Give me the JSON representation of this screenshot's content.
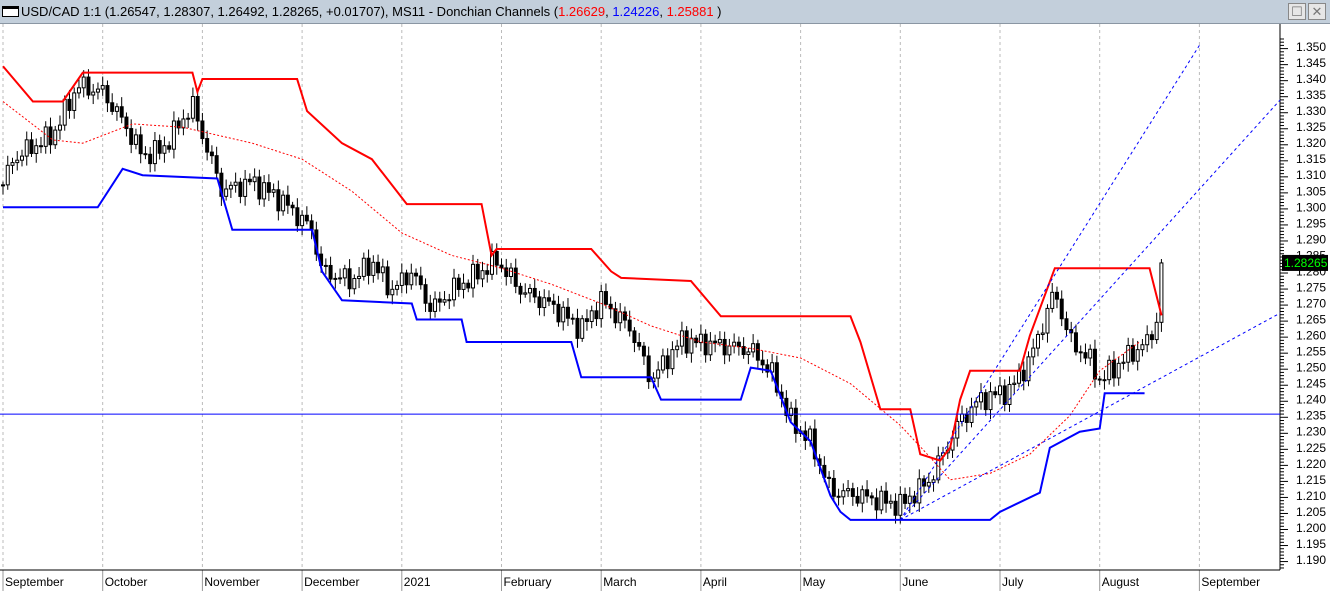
{
  "window": {
    "symbol_info": "USD/CAD 1:1 (1.26547, 1.28307, 1.26492, 1.28265, +0.01707), MS11 - Donchian Channels (",
    "upper": "1.26629",
    "sep1": ", ",
    "lower": "1.24226",
    "sep2": ", ",
    "middle": "1.25881",
    "close_paren": " )",
    "maximize": "☐",
    "close": "✕"
  },
  "colors": {
    "upper": "#ff0000",
    "lower": "#0000ff",
    "middle": "#ff0000",
    "current_price_bg": "#000000",
    "current_price_fg": "#00ff00"
  },
  "chart_data": {
    "type": "candlestick",
    "title": "USD/CAD 1:1",
    "ylim": [
      1.1875,
      1.3525
    ],
    "y_ticks": [
      "1.350",
      "1.345",
      "1.340",
      "1.335",
      "1.330",
      "1.325",
      "1.320",
      "1.315",
      "1.310",
      "1.305",
      "1.300",
      "1.295",
      "1.290",
      "1.285",
      "1.280",
      "1.275",
      "1.270",
      "1.265",
      "1.260",
      "1.255",
      "1.250",
      "1.245",
      "1.240",
      "1.235",
      "1.230",
      "1.225",
      "1.220",
      "1.215",
      "1.210",
      "1.205",
      "1.200",
      "1.195",
      "1.190"
    ],
    "x_labels": [
      "September",
      "October",
      "November",
      "December",
      "2021",
      "February",
      "March",
      "April",
      "May",
      "June",
      "July",
      "August",
      "September"
    ],
    "current_price": "1.28265",
    "close_path": [
      [
        0,
        1.307
      ],
      [
        0.1,
        1.315
      ],
      [
        0.25,
        1.318
      ],
      [
        0.5,
        1.3225
      ],
      [
        0.75,
        1.338
      ],
      [
        1.0,
        1.336
      ],
      [
        1.2,
        1.327
      ],
      [
        1.4,
        1.316
      ],
      [
        1.6,
        1.318
      ],
      [
        1.9,
        1.332
      ],
      [
        2.05,
        1.318
      ],
      [
        2.2,
        1.305
      ],
      [
        2.5,
        1.308
      ],
      [
        2.8,
        1.302
      ],
      [
        3.1,
        1.293
      ],
      [
        3.2,
        1.28
      ],
      [
        3.5,
        1.277
      ],
      [
        3.7,
        1.283
      ],
      [
        3.9,
        1.274
      ],
      [
        4.1,
        1.28
      ],
      [
        4.3,
        1.268
      ],
      [
        4.5,
        1.274
      ],
      [
        4.8,
        1.28
      ],
      [
        4.95,
        1.2835
      ],
      [
        5.2,
        1.274
      ],
      [
        5.5,
        1.2695
      ],
      [
        5.8,
        1.262
      ],
      [
        6.0,
        1.271
      ],
      [
        6.3,
        1.262
      ],
      [
        6.5,
        1.246
      ],
      [
        6.8,
        1.2585
      ],
      [
        7.2,
        1.257
      ],
      [
        7.5,
        1.2555
      ],
      [
        7.7,
        1.249
      ],
      [
        7.9,
        1.2335
      ],
      [
        8.1,
        1.227
      ],
      [
        8.3,
        1.2115
      ],
      [
        8.6,
        1.21
      ],
      [
        9.0,
        1.207
      ],
      [
        9.3,
        1.215
      ],
      [
        9.6,
        1.2335
      ],
      [
        9.8,
        1.24
      ],
      [
        10.1,
        1.243
      ],
      [
        10.3,
        1.2525
      ],
      [
        10.55,
        1.274
      ],
      [
        10.7,
        1.2585
      ],
      [
        10.9,
        1.2525
      ],
      [
        11.0,
        1.246
      ],
      [
        11.3,
        1.254
      ],
      [
        11.5,
        1.2585
      ],
      [
        11.58,
        1.266
      ],
      [
        11.62,
        1.28265
      ]
    ],
    "donchian_upper": [
      [
        0,
        1.344
      ],
      [
        0.3,
        1.333
      ],
      [
        0.6,
        1.333
      ],
      [
        0.8,
        1.342
      ],
      [
        1.9,
        1.342
      ],
      [
        1.95,
        1.336
      ],
      [
        2.0,
        1.34
      ],
      [
        2.95,
        1.34
      ],
      [
        3.05,
        1.33
      ],
      [
        3.4,
        1.32
      ],
      [
        3.7,
        1.315
      ],
      [
        3.95,
        1.305
      ],
      [
        4.05,
        1.301
      ],
      [
        4.8,
        1.301
      ],
      [
        4.9,
        1.285
      ],
      [
        4.95,
        1.287
      ],
      [
        5.9,
        1.287
      ],
      [
        6.1,
        1.28
      ],
      [
        6.2,
        1.278
      ],
      [
        6.9,
        1.277
      ],
      [
        7.2,
        1.266
      ],
      [
        8.5,
        1.266
      ],
      [
        8.6,
        1.258
      ],
      [
        8.8,
        1.237
      ],
      [
        9.1,
        1.237
      ],
      [
        9.2,
        1.223
      ],
      [
        9.4,
        1.221
      ],
      [
        9.5,
        1.225
      ],
      [
        9.6,
        1.24
      ],
      [
        9.7,
        1.249
      ],
      [
        10.2,
        1.249
      ],
      [
        10.3,
        1.26
      ],
      [
        10.55,
        1.281
      ],
      [
        11.5,
        1.281
      ],
      [
        11.62,
        1.2663
      ]
    ],
    "donchian_lower": [
      [
        0,
        1.3
      ],
      [
        0.95,
        1.3
      ],
      [
        1.2,
        1.312
      ],
      [
        1.4,
        1.31
      ],
      [
        2.15,
        1.309
      ],
      [
        2.3,
        1.293
      ],
      [
        3.1,
        1.293
      ],
      [
        3.2,
        1.28
      ],
      [
        3.4,
        1.271
      ],
      [
        4.1,
        1.27
      ],
      [
        4.15,
        1.265
      ],
      [
        4.6,
        1.265
      ],
      [
        4.65,
        1.258
      ],
      [
        5.7,
        1.258
      ],
      [
        5.8,
        1.247
      ],
      [
        6.5,
        1.247
      ],
      [
        6.6,
        1.24
      ],
      [
        7.4,
        1.24
      ],
      [
        7.5,
        1.25
      ],
      [
        7.7,
        1.249
      ],
      [
        7.9,
        1.233
      ],
      [
        8.1,
        1.227
      ],
      [
        8.3,
        1.21
      ],
      [
        8.4,
        1.205
      ],
      [
        8.5,
        1.2025
      ],
      [
        9.9,
        1.2025
      ],
      [
        10.0,
        1.205
      ],
      [
        10.4,
        1.211
      ],
      [
        10.5,
        1.225
      ],
      [
        10.8,
        1.23
      ],
      [
        11.0,
        1.231
      ],
      [
        11.05,
        1.242
      ],
      [
        11.45,
        1.242
      ]
    ],
    "donchian_middle": [
      [
        0,
        1.333
      ],
      [
        0.5,
        1.321
      ],
      [
        0.8,
        1.32
      ],
      [
        1.3,
        1.326
      ],
      [
        1.8,
        1.325
      ],
      [
        2.5,
        1.32
      ],
      [
        3.0,
        1.315
      ],
      [
        3.5,
        1.305
      ],
      [
        4.0,
        1.292
      ],
      [
        4.5,
        1.285
      ],
      [
        5.0,
        1.281
      ],
      [
        5.5,
        1.276
      ],
      [
        6.0,
        1.27
      ],
      [
        6.5,
        1.263
      ],
      [
        7.0,
        1.258
      ],
      [
        7.5,
        1.256
      ],
      [
        8.0,
        1.253
      ],
      [
        8.5,
        1.245
      ],
      [
        9.0,
        1.232
      ],
      [
        9.3,
        1.222
      ],
      [
        9.5,
        1.215
      ],
      [
        9.9,
        1.217
      ],
      [
        10.3,
        1.223
      ],
      [
        10.7,
        1.235
      ],
      [
        11.0,
        1.249
      ],
      [
        11.4,
        1.258
      ]
    ],
    "horizontal_line": 1.2355,
    "trendlines": [
      [
        [
          9.0,
          1.2025
        ],
        [
          12.0,
          1.3505
        ]
      ],
      [
        [
          9.0,
          1.2025
        ],
        [
          12.81,
          1.3335
        ]
      ],
      [
        [
          9.0,
          1.2025
        ],
        [
          12.81,
          1.267
        ]
      ]
    ]
  }
}
